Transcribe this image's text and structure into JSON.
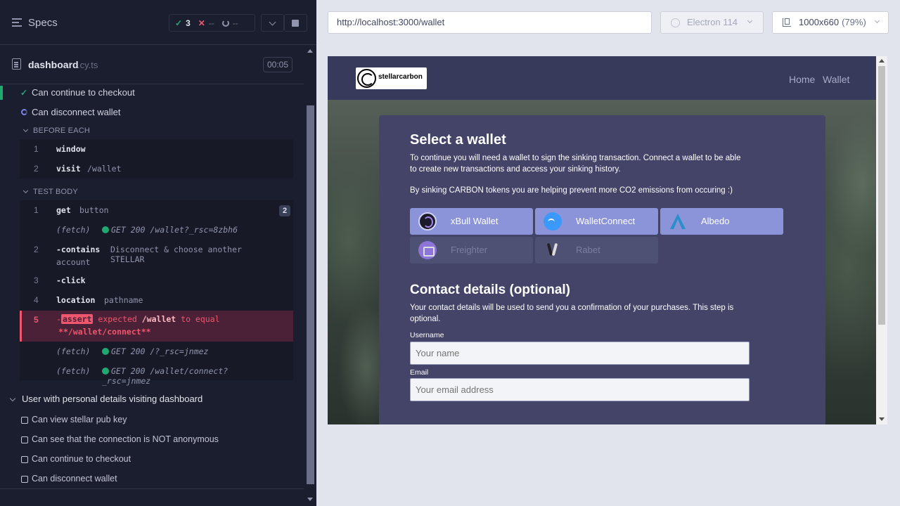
{
  "reporter": {
    "specs_label": "Specs",
    "stats": {
      "passed": "3",
      "failed": "--",
      "pending": "--"
    },
    "file": {
      "name": "dashboard",
      "ext": ".cy.ts",
      "duration": "00:05"
    },
    "tests_top": [
      {
        "title": "Can continue to checkout",
        "state": "passed"
      },
      {
        "title": "Can disconnect wallet",
        "state": "running"
      }
    ],
    "before_each": {
      "label": "BEFORE EACH",
      "commands": [
        {
          "num": "1",
          "name": "window",
          "msg": ""
        },
        {
          "num": "2",
          "name": "visit",
          "msg": "/wallet"
        }
      ]
    },
    "test_body": {
      "label": "TEST BODY",
      "cmd1": {
        "num": "1",
        "name": "get",
        "msg": "button",
        "badge": "2"
      },
      "fetch1": {
        "label": "(fetch)",
        "msg": "GET 200 /wallet?_rsc=8zbh6"
      },
      "cmd2": {
        "num": "2",
        "name": "-contains",
        "msg": "Disconnect & choose another STELLAR",
        "msg2": "account"
      },
      "cmd3": {
        "num": "3",
        "name": "-click"
      },
      "cmd4": {
        "num": "4",
        "name": "location",
        "msg": "pathname"
      },
      "assert": {
        "num": "5",
        "dash": "-",
        "tag": "assert",
        "expected": "expected",
        "value1": "/wallet",
        "to_equal": "to equal",
        "value2": "**/wallet/connect**"
      },
      "fetch2": {
        "label": "(fetch)",
        "msg": "GET 200 /?_rsc=jnmez"
      },
      "fetch3": {
        "label": "(fetch)",
        "msg": "GET 200 /wallet/connect?_rsc=jnmez"
      }
    },
    "suite": {
      "title": "User with personal details visiting dashboard",
      "tests": [
        "Can view stellar pub key",
        "Can see that the connection is NOT anonymous",
        "Can continue to checkout",
        "Can disconnect wallet"
      ]
    }
  },
  "aut": {
    "url": "http://localhost:3000/wallet",
    "browser": "Electron 114",
    "viewport": "1000x660",
    "zoom": "(79%)",
    "site": {
      "logo_text": "stellarcarbon",
      "nav": [
        "Home",
        "Wallet"
      ],
      "heading": "Select a wallet",
      "intro": "To continue you will need a wallet to sign the sinking transaction. Connect a wallet to be able to create new transactions and access your sinking history.",
      "note": "By sinking CARBON tokens you are helping prevent more CO2 emissions from occuring :)",
      "wallets": [
        {
          "name": "xBull Wallet",
          "icon": "xbull-icon",
          "enabled": true
        },
        {
          "name": "WalletConnect",
          "icon": "walletconnect-icon",
          "enabled": true
        },
        {
          "name": "Albedo",
          "icon": "albedo-icon",
          "enabled": true
        },
        {
          "name": "Freighter",
          "icon": "freighter-icon",
          "enabled": false
        },
        {
          "name": "Rabet",
          "icon": "rabet-icon",
          "enabled": false
        }
      ],
      "contact_heading": "Contact details (optional)",
      "contact_text": "Your contact details will be used to send you a confirmation of your purchases. This step is optional.",
      "username_label": "Username",
      "username_placeholder": "Your name",
      "email_label": "Email",
      "email_placeholder": "Your email address"
    }
  },
  "colors": {
    "passed": "#1fa971",
    "failed": "#f0566e",
    "accent": "#8b94d9",
    "reporter_bg": "#1b1e2e"
  }
}
